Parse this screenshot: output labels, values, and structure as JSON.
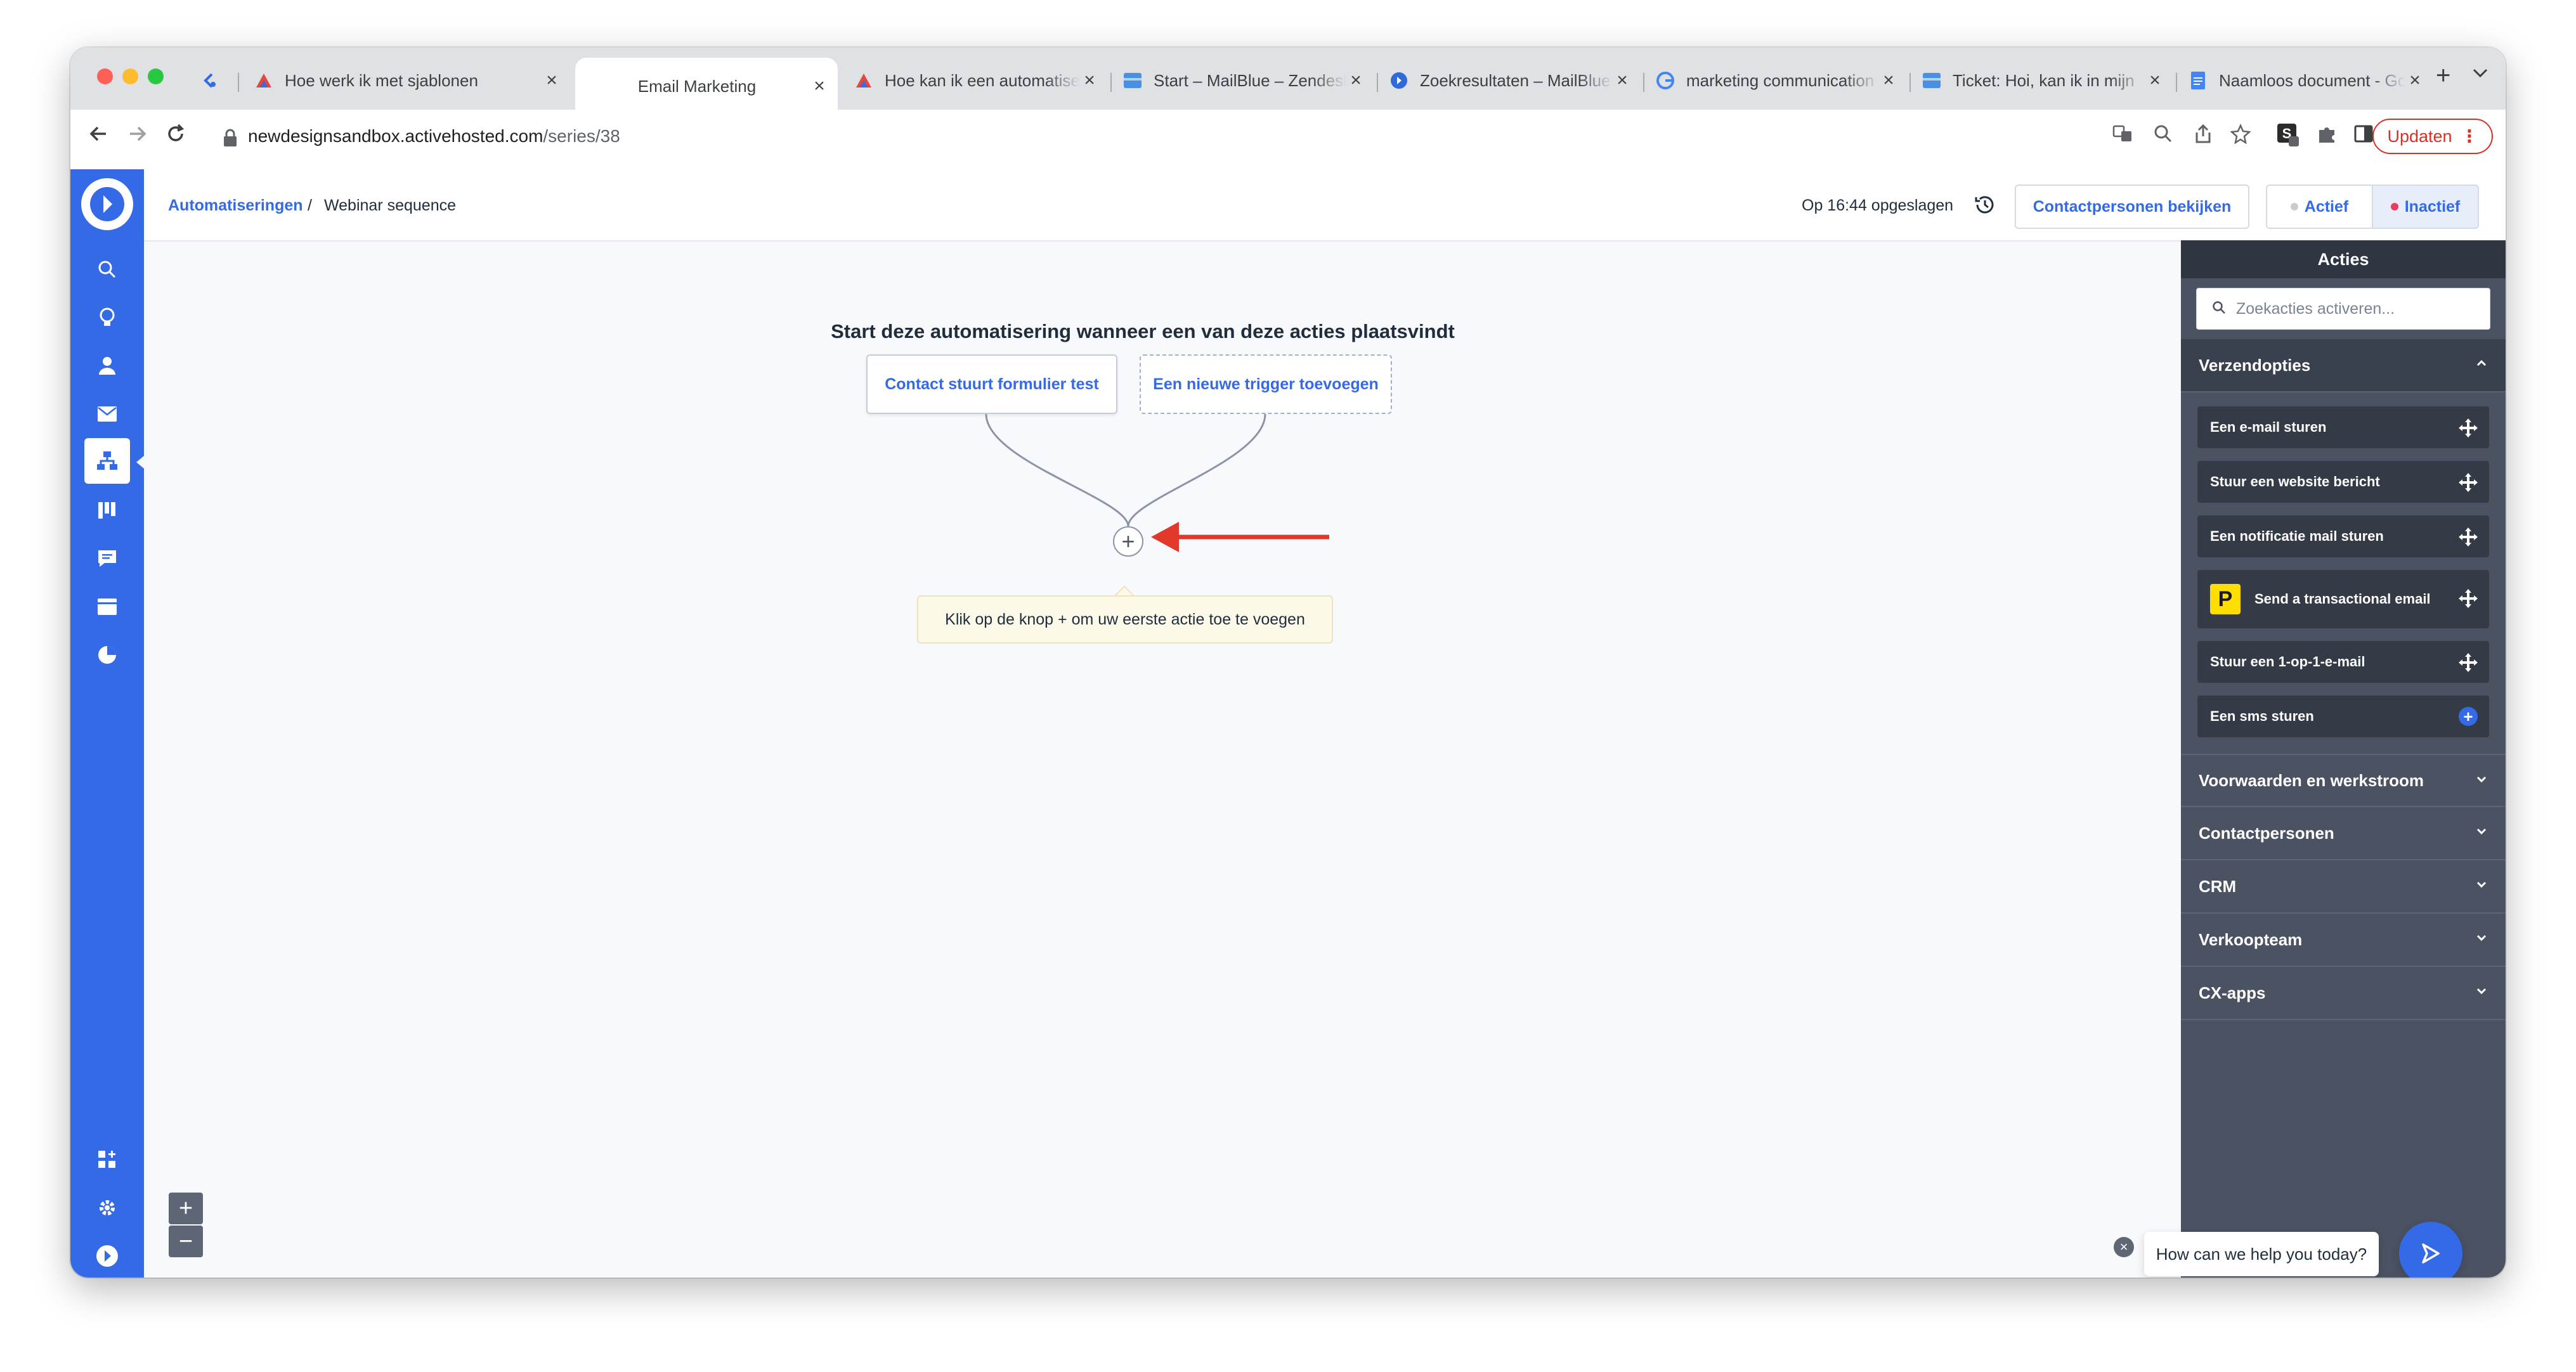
{
  "browser": {
    "tabs": [
      {
        "title": "",
        "favicon": "activecampaign-chevron-icon"
      },
      {
        "title": "Hoe werk ik met sjablonen",
        "favicon": "mailblue-icon"
      },
      {
        "title": "Email Marketing",
        "favicon": "",
        "active": true
      },
      {
        "title": "Hoe kan ik een automatisering",
        "favicon": "mailblue-icon"
      },
      {
        "title": "Start – MailBlue – Zendesk",
        "favicon": "zendesk-icon"
      },
      {
        "title": "Zoekresultaten – MailBlue",
        "favicon": "help-center-icon"
      },
      {
        "title": "marketing communication",
        "favicon": "google-icon"
      },
      {
        "title": "Ticket: Hoi, kan ik in mijn",
        "favicon": "zendesk-icon"
      },
      {
        "title": "Naamloos document - Google Docs",
        "favicon": "docs-icon"
      }
    ],
    "address": {
      "host": "newdesignsandbox.activehosted.com",
      "path": "/series/38"
    },
    "update_label": "Updaten"
  },
  "app": {
    "breadcrumb": {
      "root": "Automatiseringen",
      "separator": "/",
      "current": "Webinar sequence"
    },
    "saved_status": "Op 16:44 opgeslagen",
    "contacts_button": "Contactpersonen bekijken",
    "status_toggle": {
      "active_label": "Actief",
      "inactive_label": "Inactief",
      "selected": "Inactief",
      "active_color": "#c7ccd4",
      "inactive_color": "#e6405e"
    },
    "brand_color": "#356ae6"
  },
  "canvas": {
    "heading": "Start deze automatisering wanneer een van deze acties plaatsvindt",
    "triggers": [
      {
        "label": "Contact stuurt formulier test"
      },
      {
        "label": "Een nieuwe trigger toevoegen"
      }
    ],
    "add_button_symbol": "+",
    "hint": "Klik op de knop + om uw eerste actie toe te voegen",
    "zoom_in": "+",
    "zoom_out": "−"
  },
  "panel": {
    "title": "Acties",
    "search_placeholder": "Zoekacties activeren...",
    "sections": [
      {
        "label": "Verzendopties",
        "expanded": true,
        "items": [
          {
            "label": "Een e-mail sturen",
            "icon": "drag-handle-icon"
          },
          {
            "label": "Stuur een website bericht",
            "icon": "drag-handle-icon"
          },
          {
            "label": "Een notificatie mail sturen",
            "icon": "drag-handle-icon"
          },
          {
            "label": "Send a transactional email",
            "icon": "drag-handle-icon",
            "logo": "P"
          },
          {
            "label": "Stuur een 1-op-1-e-mail",
            "icon": "drag-handle-icon"
          },
          {
            "label": "Een sms sturen",
            "icon": "plus-circle-icon"
          }
        ]
      },
      {
        "label": "Voorwaarden en werkstroom",
        "expanded": false
      },
      {
        "label": "Contactpersonen",
        "expanded": false
      },
      {
        "label": "CRM",
        "expanded": false
      },
      {
        "label": "Verkoopteam",
        "expanded": false
      },
      {
        "label": "CX-apps",
        "expanded": false
      }
    ]
  },
  "chat": {
    "prompt": "How can we help you today?",
    "close_symbol": "×"
  },
  "sidebar": {
    "items": [
      "search-icon",
      "lightbulb-icon",
      "contacts-icon",
      "campaigns-icon",
      "automations-icon",
      "pipelines-icon",
      "conversations-icon",
      "website-icon",
      "reports-icon"
    ],
    "bottom_items": [
      "apps-icon",
      "settings-icon",
      "account-icon"
    ]
  }
}
